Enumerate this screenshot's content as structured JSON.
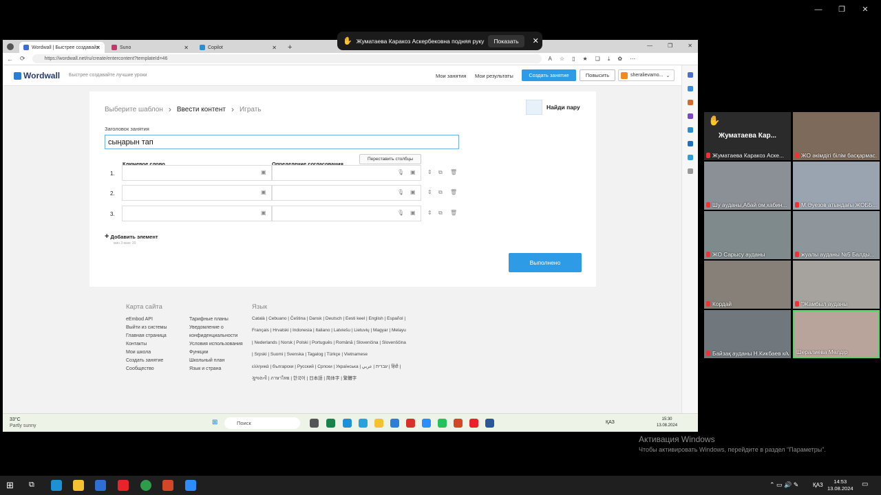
{
  "notification": {
    "icon": "raised-hand-icon",
    "text": "Жуматаева Каракоз Аскербековна подняя руку",
    "button": "Показать"
  },
  "browser": {
    "tabs": [
      {
        "label": "Wordwall | Быстрее создавайт",
        "color": "#3d6fd1"
      },
      {
        "label": "Suno",
        "color": "#c0396b"
      },
      {
        "label": "Copilot",
        "color": "#2a8fd1"
      }
    ],
    "url": "https://wordwall.net/ru/create/entercontent?templateId=46"
  },
  "wordwall": {
    "logo": "Wordwall",
    "tagline": "Быстрее создавайте лучшие уроки",
    "my_activities": "Мои занятия",
    "my_results": "Мои результаты",
    "create": "Создать занятие",
    "upgrade": "Повысить",
    "user": "sheralievamo...",
    "steps": [
      "Выберите шаблон",
      "Ввести контент",
      "Играть"
    ],
    "template_name": "Найди пару",
    "title_label": "Заголовок занятия",
    "title_value": "сыңарын тап",
    "swap_columns": "Переставить столбцы",
    "col_keyword": "Ключевое слово",
    "col_definition": "Определение согласования",
    "rows": [
      "1.",
      "2.",
      "3."
    ],
    "add_item": "Добавить элемент",
    "min_max": "мин 3  макс 20",
    "done": "Выполнено"
  },
  "footer": {
    "sitemap": "Карта сайта",
    "col1": [
      "eEmbod API",
      "Выйти из системы",
      "Главная страница",
      "Контакты",
      "Мои школа",
      "Создать занятие",
      "Сообщество"
    ],
    "col2": [
      "Тарифные планы",
      "Уведомление о конфиденциальности",
      "Условия использования",
      "Функции",
      "Школьный план",
      "Язык и страна"
    ],
    "language": "Язык",
    "langs": [
      "Català | Cebuano | Čeština | Dansk | Deutsch | Eesti keel | English | Español |",
      "Français | Hrvatski | Indonesia | Italiano | Latviešu | Lietuvių | Magyar | Melayu",
      "| Nederlands | Norsk | Polski | Português | Română | Slovenčina | Slovenščina",
      "| Srpski | Suomi | Svenska | Tagalog | Türkçe | Vietnamese",
      "ελληνικά | български | Русский | Српски | Українська | עברית | عربي | हिंदी |",
      "ગુજરાતી | ภาษาไทย | 한국어 | 日本語 | 简体字 | 繁體字"
    ]
  },
  "shared_taskbar": {
    "weather": "33°C",
    "weather_desc": "Partly sunny",
    "search": "Поиск",
    "lang": "ҚАЗ",
    "time": "15:30",
    "date": "13.08.2024"
  },
  "gallery": [
    {
      "name": "Жуматаева Каракоз Аске...",
      "big_name": "Жуматаева  Кар...",
      "bg": "#262626"
    },
    {
      "name": "ЖО әкімдігі білім басқармас...",
      "bg": "#7d6a5a"
    },
    {
      "name": "Шу ауданы,Абай ом,кабин...",
      "bg": "#8b8f96"
    },
    {
      "name": "М.Әуезов атындағы ЖОББ...",
      "bg": "#9aa3b0"
    },
    {
      "name": "ЖО Сарысу ауданы",
      "bg": "#7f8a8c"
    },
    {
      "name": "жуалы ауданы №5 Балды...",
      "bg": "#8e969c"
    },
    {
      "name": "Кордай",
      "bg": "#868078"
    },
    {
      "name": "\"Жамбыл ауданы",
      "bg": "#a6a29e"
    },
    {
      "name": "Байзақ ауданы Н.Кикбаев к/м",
      "bg": "#70787e"
    },
    {
      "name": "Шералиева Мөлдір",
      "bg": "#b8a49a"
    }
  ],
  "activation": {
    "title": "Активация Windows",
    "text": "Чтобы активировать Windows, перейдите в раздел \"Параметры\"."
  },
  "taskbar": {
    "lang": "ҚАЗ",
    "time": "14:53",
    "date": "13.08.2024"
  }
}
